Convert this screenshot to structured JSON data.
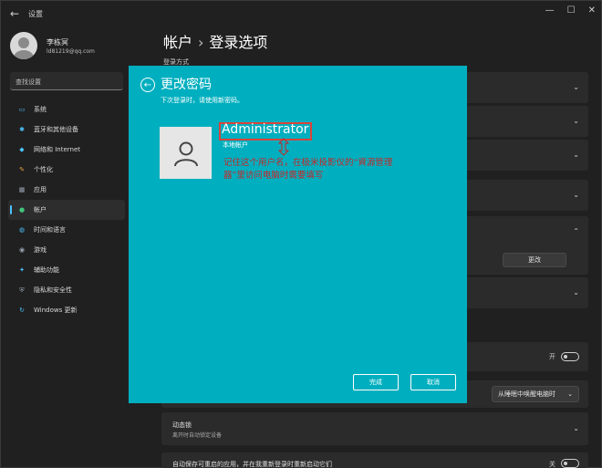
{
  "window": {
    "app_title": "设置",
    "back_glyph": "←",
    "minimize_glyph": "—",
    "maximize_glyph": "☐",
    "close_glyph": "✕"
  },
  "user": {
    "name": "李栋冥",
    "email": "ld81219@qq.com"
  },
  "search": {
    "placeholder": "查找设置"
  },
  "sidebar": {
    "accent_color": "#4cc2ff",
    "items": [
      {
        "label": "系统",
        "icon": "monitor-icon",
        "glyph": "▭",
        "color": "#4cc2ff"
      },
      {
        "label": "蓝牙和其他设备",
        "icon": "bluetooth-icon",
        "glyph": "✱",
        "color": "#4cc2ff"
      },
      {
        "label": "网络和 Internet",
        "icon": "wifi-icon",
        "glyph": "◆",
        "color": "#4cc2ff"
      },
      {
        "label": "个性化",
        "icon": "brush-icon",
        "glyph": "✎",
        "color": "#e6a23c"
      },
      {
        "label": "应用",
        "icon": "apps-icon",
        "glyph": "▦",
        "color": "#9aa4b2"
      },
      {
        "label": "帐户",
        "icon": "account-icon",
        "glyph": "●",
        "color": "#3fc77b",
        "active": true
      },
      {
        "label": "时间和语言",
        "icon": "globe-icon",
        "glyph": "◍",
        "color": "#4cc2ff"
      },
      {
        "label": "游戏",
        "icon": "gamepad-icon",
        "glyph": "◉",
        "color": "#9aa4b2"
      },
      {
        "label": "辅助功能",
        "icon": "accessibility-icon",
        "glyph": "✦",
        "color": "#4cc2ff"
      },
      {
        "label": "隐私和安全性",
        "icon": "shield-icon",
        "glyph": "⛨",
        "color": "#9aa4b2"
      },
      {
        "label": "Windows 更新",
        "icon": "update-icon",
        "glyph": "↻",
        "color": "#4cc2ff"
      }
    ]
  },
  "page": {
    "breadcrumb_parent": "帐户",
    "breadcrumb_sep": "›",
    "breadcrumb_current": "登录选项",
    "section_label": "登录方式"
  },
  "background_rows": {
    "chevron": "⌄",
    "chevron_up": "⌃",
    "change_button": "更改",
    "toggle_label": "开",
    "dropdown_value": "从睡眠中唤醒电脑时",
    "dynamic_lock_title": "动态锁",
    "dynamic_lock_sub": "离开时自动锁定设备",
    "restart_apps_title": "自动保存可重启的应用，并在我重新登录时重新启动它们",
    "restart_apps_toggle": "关"
  },
  "dialog": {
    "background": "#00afbf",
    "back_glyph": "←",
    "title": "更改密码",
    "subtitle": "下次登录时，请使用新密码。",
    "account_name": "Administrator",
    "account_type": "本地帐户",
    "annotation_arrow": "⇕",
    "annotation": "记住这个用户名，在极米投影仪的“資源管理器”里访问电脑时需要填写",
    "annotation_color": "#c62828",
    "finish_button": "完成",
    "cancel_button": "取消"
  }
}
